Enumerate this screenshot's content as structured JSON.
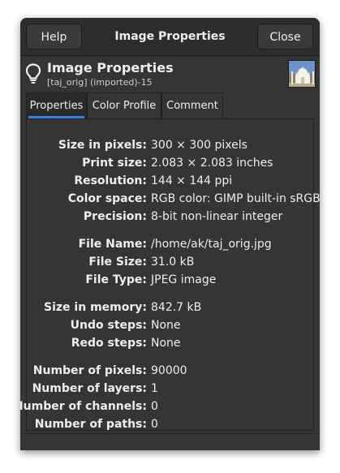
{
  "headerbar": {
    "help_label": "Help",
    "title": "Image Properties",
    "close_label": "Close"
  },
  "info": {
    "title": "Image Properties",
    "subtitle": "[taj_orig] (imported)-15",
    "icon": "lightbulb-icon"
  },
  "tabs": [
    "Properties",
    "Color Profile",
    "Comment"
  ],
  "properties": [
    {
      "label": "Size in pixels:",
      "value": "300 × 300 pixels"
    },
    {
      "label": "Print size:",
      "value": "2.083 × 2.083 inches"
    },
    {
      "label": "Resolution:",
      "value": "144 × 144 ppi"
    },
    {
      "label": "Color space:",
      "value": "RGB color: GIMP built-in sRGB"
    },
    {
      "label": "Precision:",
      "value": "8-bit non-linear integer"
    },
    {
      "label": "File Name:",
      "value": "/home/ak/taj_orig.jpg"
    },
    {
      "label": "File Size:",
      "value": "31.0 kB"
    },
    {
      "label": "File Type:",
      "value": "JPEG image"
    },
    {
      "label": "Size in memory:",
      "value": "842.7 kB"
    },
    {
      "label": "Undo steps:",
      "value": "None"
    },
    {
      "label": "Redo steps:",
      "value": "None"
    },
    {
      "label": "Number of pixels:",
      "value": "90000"
    },
    {
      "label": "Number of layers:",
      "value": "1"
    },
    {
      "label": "Number of channels:",
      "value": "0"
    },
    {
      "label": "Number of paths:",
      "value": "0"
    }
  ],
  "colors": {
    "window_bg": "#353535",
    "headerbar_bg": "#2d2d2d",
    "text": "#eeeeec",
    "accent": "#3584e4"
  }
}
